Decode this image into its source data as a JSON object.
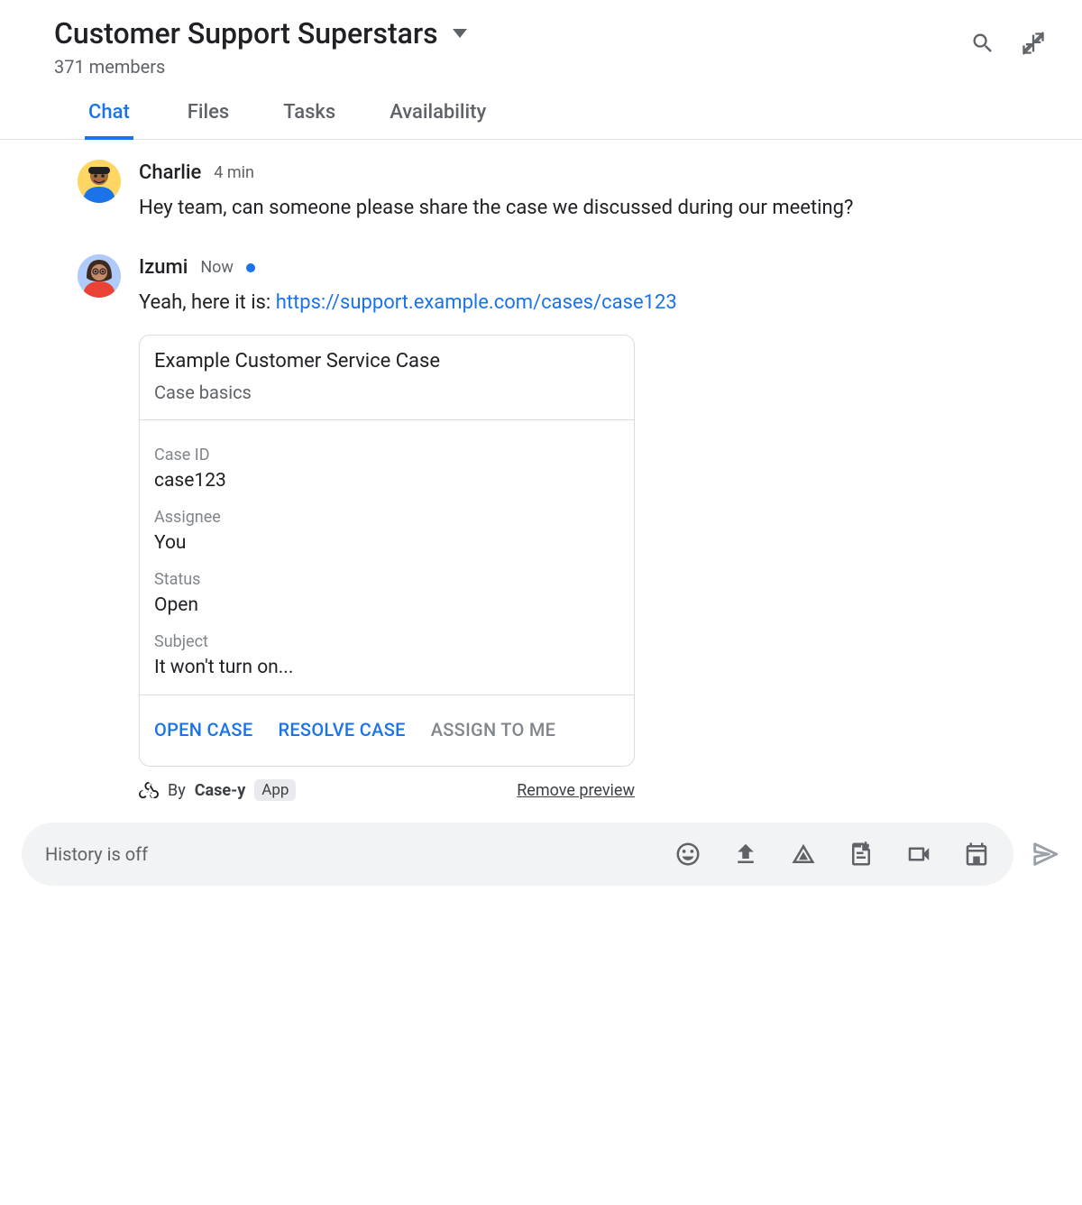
{
  "header": {
    "title": "Customer Support Superstars",
    "member_count": "371 members"
  },
  "tabs": [
    {
      "label": "Chat",
      "active": true
    },
    {
      "label": "Files",
      "active": false
    },
    {
      "label": "Tasks",
      "active": false
    },
    {
      "label": "Availability",
      "active": false
    }
  ],
  "messages": [
    {
      "author": "Charlie",
      "time": "4 min",
      "text": "Hey team, can someone please share the case we discussed during our meeting?"
    },
    {
      "author": "Izumi",
      "time": "Now",
      "presence": true,
      "text_prefix": "Yeah, here it is: ",
      "link_text": "https://support.example.com/cases/case123",
      "card": {
        "title": "Example Customer Service Case",
        "subtitle": "Case basics",
        "fields": [
          {
            "label": "Case ID",
            "value": "case123"
          },
          {
            "label": "Assignee",
            "value": "You"
          },
          {
            "label": "Status",
            "value": "Open"
          },
          {
            "label": "Subject",
            "value": "It won't turn on..."
          }
        ],
        "actions": [
          {
            "label": "OPEN CASE",
            "disabled": false
          },
          {
            "label": "RESOLVE CASE",
            "disabled": false
          },
          {
            "label": "ASSIGN TO ME",
            "disabled": true
          }
        ],
        "by_prefix": "By",
        "app_name": "Case-y",
        "app_badge": "App",
        "remove_label": "Remove preview"
      }
    }
  ],
  "composer": {
    "placeholder": "History is off"
  }
}
